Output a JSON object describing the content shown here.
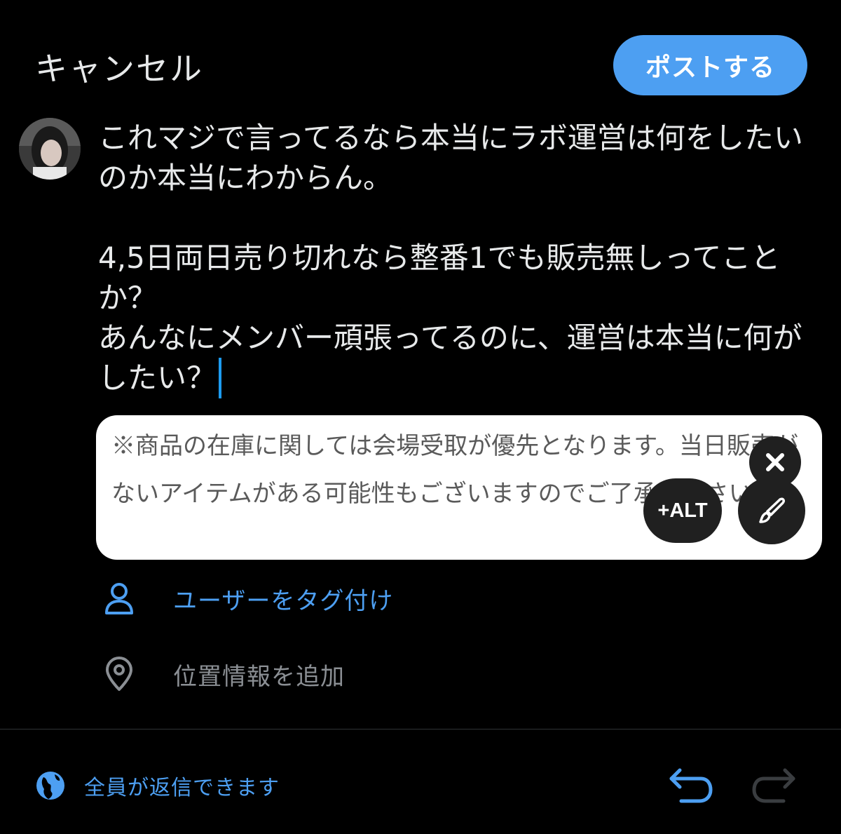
{
  "header": {
    "cancel_label": "キャンセル",
    "post_label": "ポストする"
  },
  "compose": {
    "text": "これマジで言ってるなら本当にラボ運営は何をしたいのか本当にわからん。\n\n4,5日両日売り切れなら整番1でも販売無しってことか？\nあんなにメンバー頑張ってるのに、運営は本当に何がしたい？"
  },
  "attachment": {
    "image_text": "※商品の在庫に関しては会場受取が優先となります。当日販売がないアイテムがある可能性もございますのでご了承ください。",
    "alt_label": "+ALT"
  },
  "actions": {
    "tag_users_label": "ユーザーをタグ付け",
    "add_location_label": "位置情報を追加"
  },
  "footer": {
    "reply_setting_label": "全員が返信できます"
  },
  "colors": {
    "accent": "#4d9ff2",
    "background": "#000000",
    "muted": "#8b8f94"
  }
}
